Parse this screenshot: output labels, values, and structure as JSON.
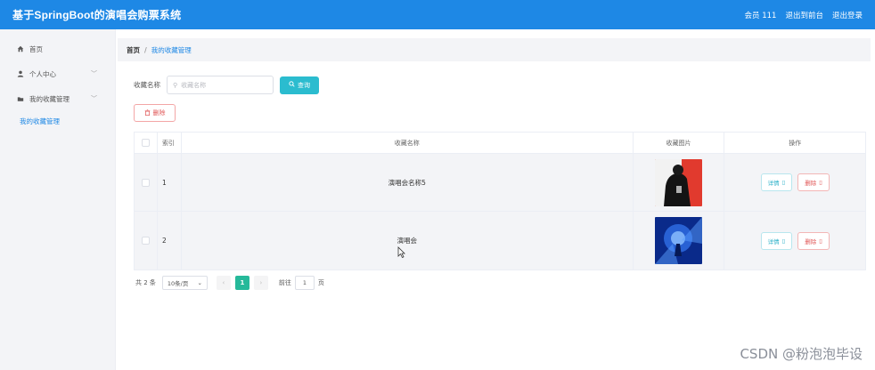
{
  "app": {
    "title": "基于SpringBoot的演唱会购票系统",
    "top_links": [
      "会员 111",
      "退出到前台",
      "退出登录"
    ]
  },
  "sidebar": {
    "items": [
      {
        "label": "首页",
        "icon": "home-icon"
      },
      {
        "label": "个人中心",
        "icon": "user-icon",
        "has_submenu": true
      },
      {
        "label": "我的收藏管理",
        "icon": "folder-icon",
        "has_submenu": true
      }
    ],
    "active_sub": "我的收藏管理"
  },
  "breadcrumb": {
    "home": "首页",
    "separator": "/",
    "current": "我的收藏管理"
  },
  "search": {
    "label": "收藏名称",
    "placeholder": "收藏名称",
    "button": "查询"
  },
  "toolbar": {
    "delete": "删除"
  },
  "table": {
    "columns": [
      "索引",
      "收藏名称",
      "收藏图片",
      "操作"
    ],
    "rows": [
      {
        "index": "1",
        "name": "演唱会名称5",
        "image": "concert-singer-photo",
        "detail": "详情",
        "delete": "删除"
      },
      {
        "index": "2",
        "name": "演唱会",
        "image": "concert-stage-photo",
        "detail": "详情",
        "delete": "删除"
      }
    ]
  },
  "pagination": {
    "total": "共 2 条",
    "page_size": "10条/页",
    "current_page": "1",
    "goto_label": "前往",
    "goto_value": "1",
    "page_suffix": "页"
  },
  "watermark": "CSDN @粉泡泡毕设",
  "colors": {
    "header": "#1e88e5",
    "search_button": "#2bbccf",
    "pager_active": "#26b99a",
    "danger": "#e05656"
  }
}
